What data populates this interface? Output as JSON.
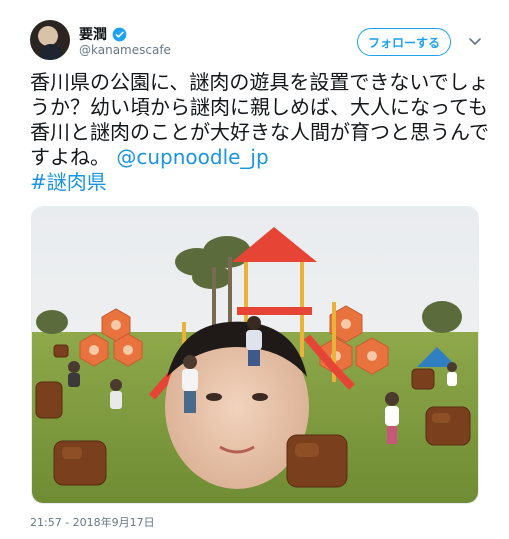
{
  "user": {
    "display_name": "要潤",
    "handle": "@kanamescafe"
  },
  "follow_button_label": "フォローする",
  "tweet": {
    "text": "香川県の公園に、謎肉の遊具を設置できないでしょうか？幼い頃から謎肉に親しめば、大人になっても香川と謎肉のことが大好きな人間が育つと思うんですよね。",
    "mention": "@cupnoodle_jp",
    "hashtag": "#謎肉県"
  },
  "timestamp": "21:57 - 2018年9月17日",
  "colors": {
    "accent": "#1da1f2",
    "link": "#1b95e0",
    "secondary_text": "#657786"
  },
  "icons": {
    "verified": "verified-badge-icon",
    "caret": "chevron-down-icon"
  }
}
